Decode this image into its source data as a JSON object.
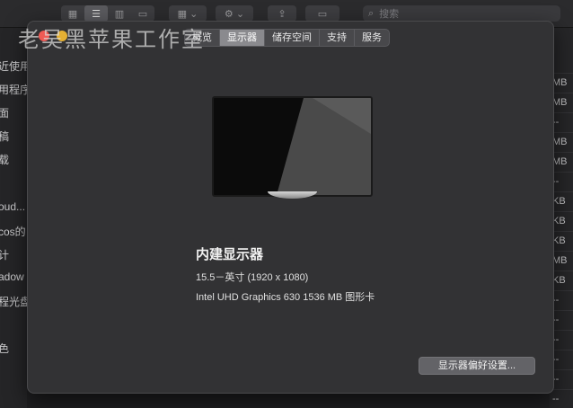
{
  "watermark": "老吴黑苹果工作室",
  "finder": {
    "search_placeholder": "搜索",
    "sidebar_items": [
      "近使用",
      "用程序",
      "面",
      "稿",
      "载",
      "oud...",
      "cos的",
      "计",
      "adow",
      "程光盘",
      "色"
    ],
    "right_column_cells": [
      "MB",
      "MB",
      "--",
      "MB",
      "MB",
      "--",
      "KB",
      "KB",
      "KB",
      "MB",
      "KB",
      "--",
      "--",
      "--",
      "--",
      "--",
      "--",
      "--",
      "--"
    ]
  },
  "about": {
    "tabs": [
      {
        "label": "概览",
        "active": false
      },
      {
        "label": "显示器",
        "active": true
      },
      {
        "label": "储存空间",
        "active": false
      },
      {
        "label": "支持",
        "active": false
      },
      {
        "label": "服务",
        "active": false
      }
    ],
    "display_name": "内建显示器",
    "size_resolution": "15.5－英寸 (1920 x 1080)",
    "graphics": "Intel UHD Graphics 630 1536 MB 图形卡",
    "prefs_button": "显示器偏好设置..."
  }
}
